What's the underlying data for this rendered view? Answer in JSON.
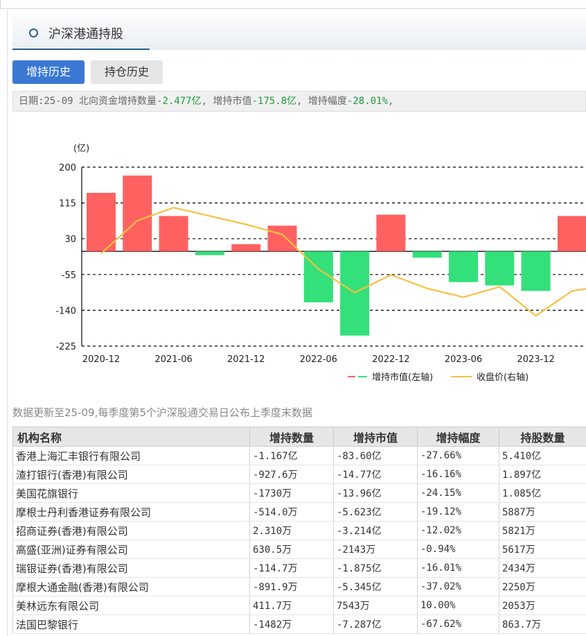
{
  "panel": {
    "title": "沪深港通持股"
  },
  "tabs": [
    {
      "label": "增持历史",
      "active": true
    },
    {
      "label": "持仓历史",
      "active": false
    }
  ],
  "summary": {
    "date_label": "日期:",
    "date": "25-09",
    "qty_label": " 北向资金增持数量",
    "qty": "-2.477亿",
    "value_label": ",  增持市值",
    "value": "-175.8亿",
    "change_label": ",  增持幅度",
    "change": "-28.01%",
    "tail": ","
  },
  "chart_data": {
    "type": "bar",
    "unit_label": "(亿)",
    "yticks": [
      200,
      115,
      30,
      -55,
      -140,
      -225
    ],
    "ylim": [
      -225,
      200
    ],
    "x_tick_labels": [
      "2020-12",
      "2021-06",
      "2021-12",
      "2022-06",
      "2022-12",
      "2023-06",
      "2023-12"
    ],
    "categories": [
      "2020-12",
      "2021-03",
      "2021-06",
      "2021-09",
      "2021-12",
      "2022-03",
      "2022-06",
      "2022-09",
      "2022-12",
      "2023-03",
      "2023-06",
      "2023-09",
      "2023-12",
      "2024-03"
    ],
    "series": [
      {
        "name": "增持市值(左轴)",
        "axis": "left",
        "values": [
          139,
          180,
          84,
          -9,
          17,
          61,
          -121,
          -200,
          87,
          -15,
          -73,
          -81,
          -94,
          84
        ],
        "positive_color": "#ff6161",
        "negative_color": "#33e07a"
      },
      {
        "name": "收盘价(右轴)",
        "axis": "right",
        "plotted_on_left_scale": [
          -5,
          73,
          104,
          84,
          64,
          40,
          -42,
          -98,
          -56,
          -88,
          -109,
          -84,
          -153,
          -94,
          -81
        ],
        "color": "#f5c240"
      }
    ],
    "grid": true,
    "legend_position": "bottom-right"
  },
  "note": "数据更新至25-09,每季度第5个沪深股通交易日公布上季度末数据",
  "table": {
    "columns": [
      "机构名称",
      "增持数量",
      "增持市值",
      "增持幅度",
      "持股数量"
    ],
    "rows": [
      {
        "name": "香港上海汇丰银行有限公司",
        "qty": "-1.167亿",
        "value": "-83.60亿",
        "change": "-27.66%",
        "holding": "5.410亿",
        "qty_sign": "neg",
        "value_sign": "neg",
        "change_sign": "neg"
      },
      {
        "name": "渣打银行(香港)有限公司",
        "qty": "-927.6万",
        "value": "-14.77亿",
        "change": "-16.16%",
        "holding": "1.897亿",
        "qty_sign": "neg",
        "value_sign": "neg",
        "change_sign": "neg"
      },
      {
        "name": "美国花旗银行",
        "qty": "-1730万",
        "value": "-13.96亿",
        "change": "-24.15%",
        "holding": "1.085亿",
        "qty_sign": "neg",
        "value_sign": "neg",
        "change_sign": "neg"
      },
      {
        "name": "摩根士丹利香港证券有限公司",
        "qty": "-514.0万",
        "value": "-5.623亿",
        "change": "-19.12%",
        "holding": "5887万",
        "qty_sign": "neg",
        "value_sign": "neg",
        "change_sign": "neg"
      },
      {
        "name": "招商证券(香港)有限公司",
        "qty": "2.310万",
        "value": "-3.214亿",
        "change": "-12.02%",
        "holding": "5821万",
        "qty_sign": "pos",
        "value_sign": "neg",
        "change_sign": "neg"
      },
      {
        "name": "高盛(亚洲)证券有限公司",
        "qty": "630.5万",
        "value": "-2143万",
        "change": "-0.94%",
        "holding": "5617万",
        "qty_sign": "pos",
        "value_sign": "neg",
        "change_sign": "neg"
      },
      {
        "name": "瑞银证券(香港)有限公司",
        "qty": "-114.7万",
        "value": "-1.875亿",
        "change": "-16.01%",
        "holding": "2434万",
        "qty_sign": "neg",
        "value_sign": "neg",
        "change_sign": "neg"
      },
      {
        "name": "摩根大通金融(香港)有限公司",
        "qty": "-891.9万",
        "value": "-5.345亿",
        "change": "-37.02%",
        "holding": "2250万",
        "qty_sign": "neg",
        "value_sign": "neg",
        "change_sign": "neg"
      },
      {
        "name": "美林远东有限公司",
        "qty": "411.7万",
        "value": "7543万",
        "change": "10.00%",
        "holding": "2053万",
        "qty_sign": "pos",
        "value_sign": "pos",
        "change_sign": "pos"
      },
      {
        "name": "法国巴黎银行",
        "qty": "-1482万",
        "value": "-7.287亿",
        "change": "-67.62%",
        "holding": "863.7万",
        "qty_sign": "neg",
        "value_sign": "neg",
        "change_sign": "neg"
      }
    ]
  }
}
